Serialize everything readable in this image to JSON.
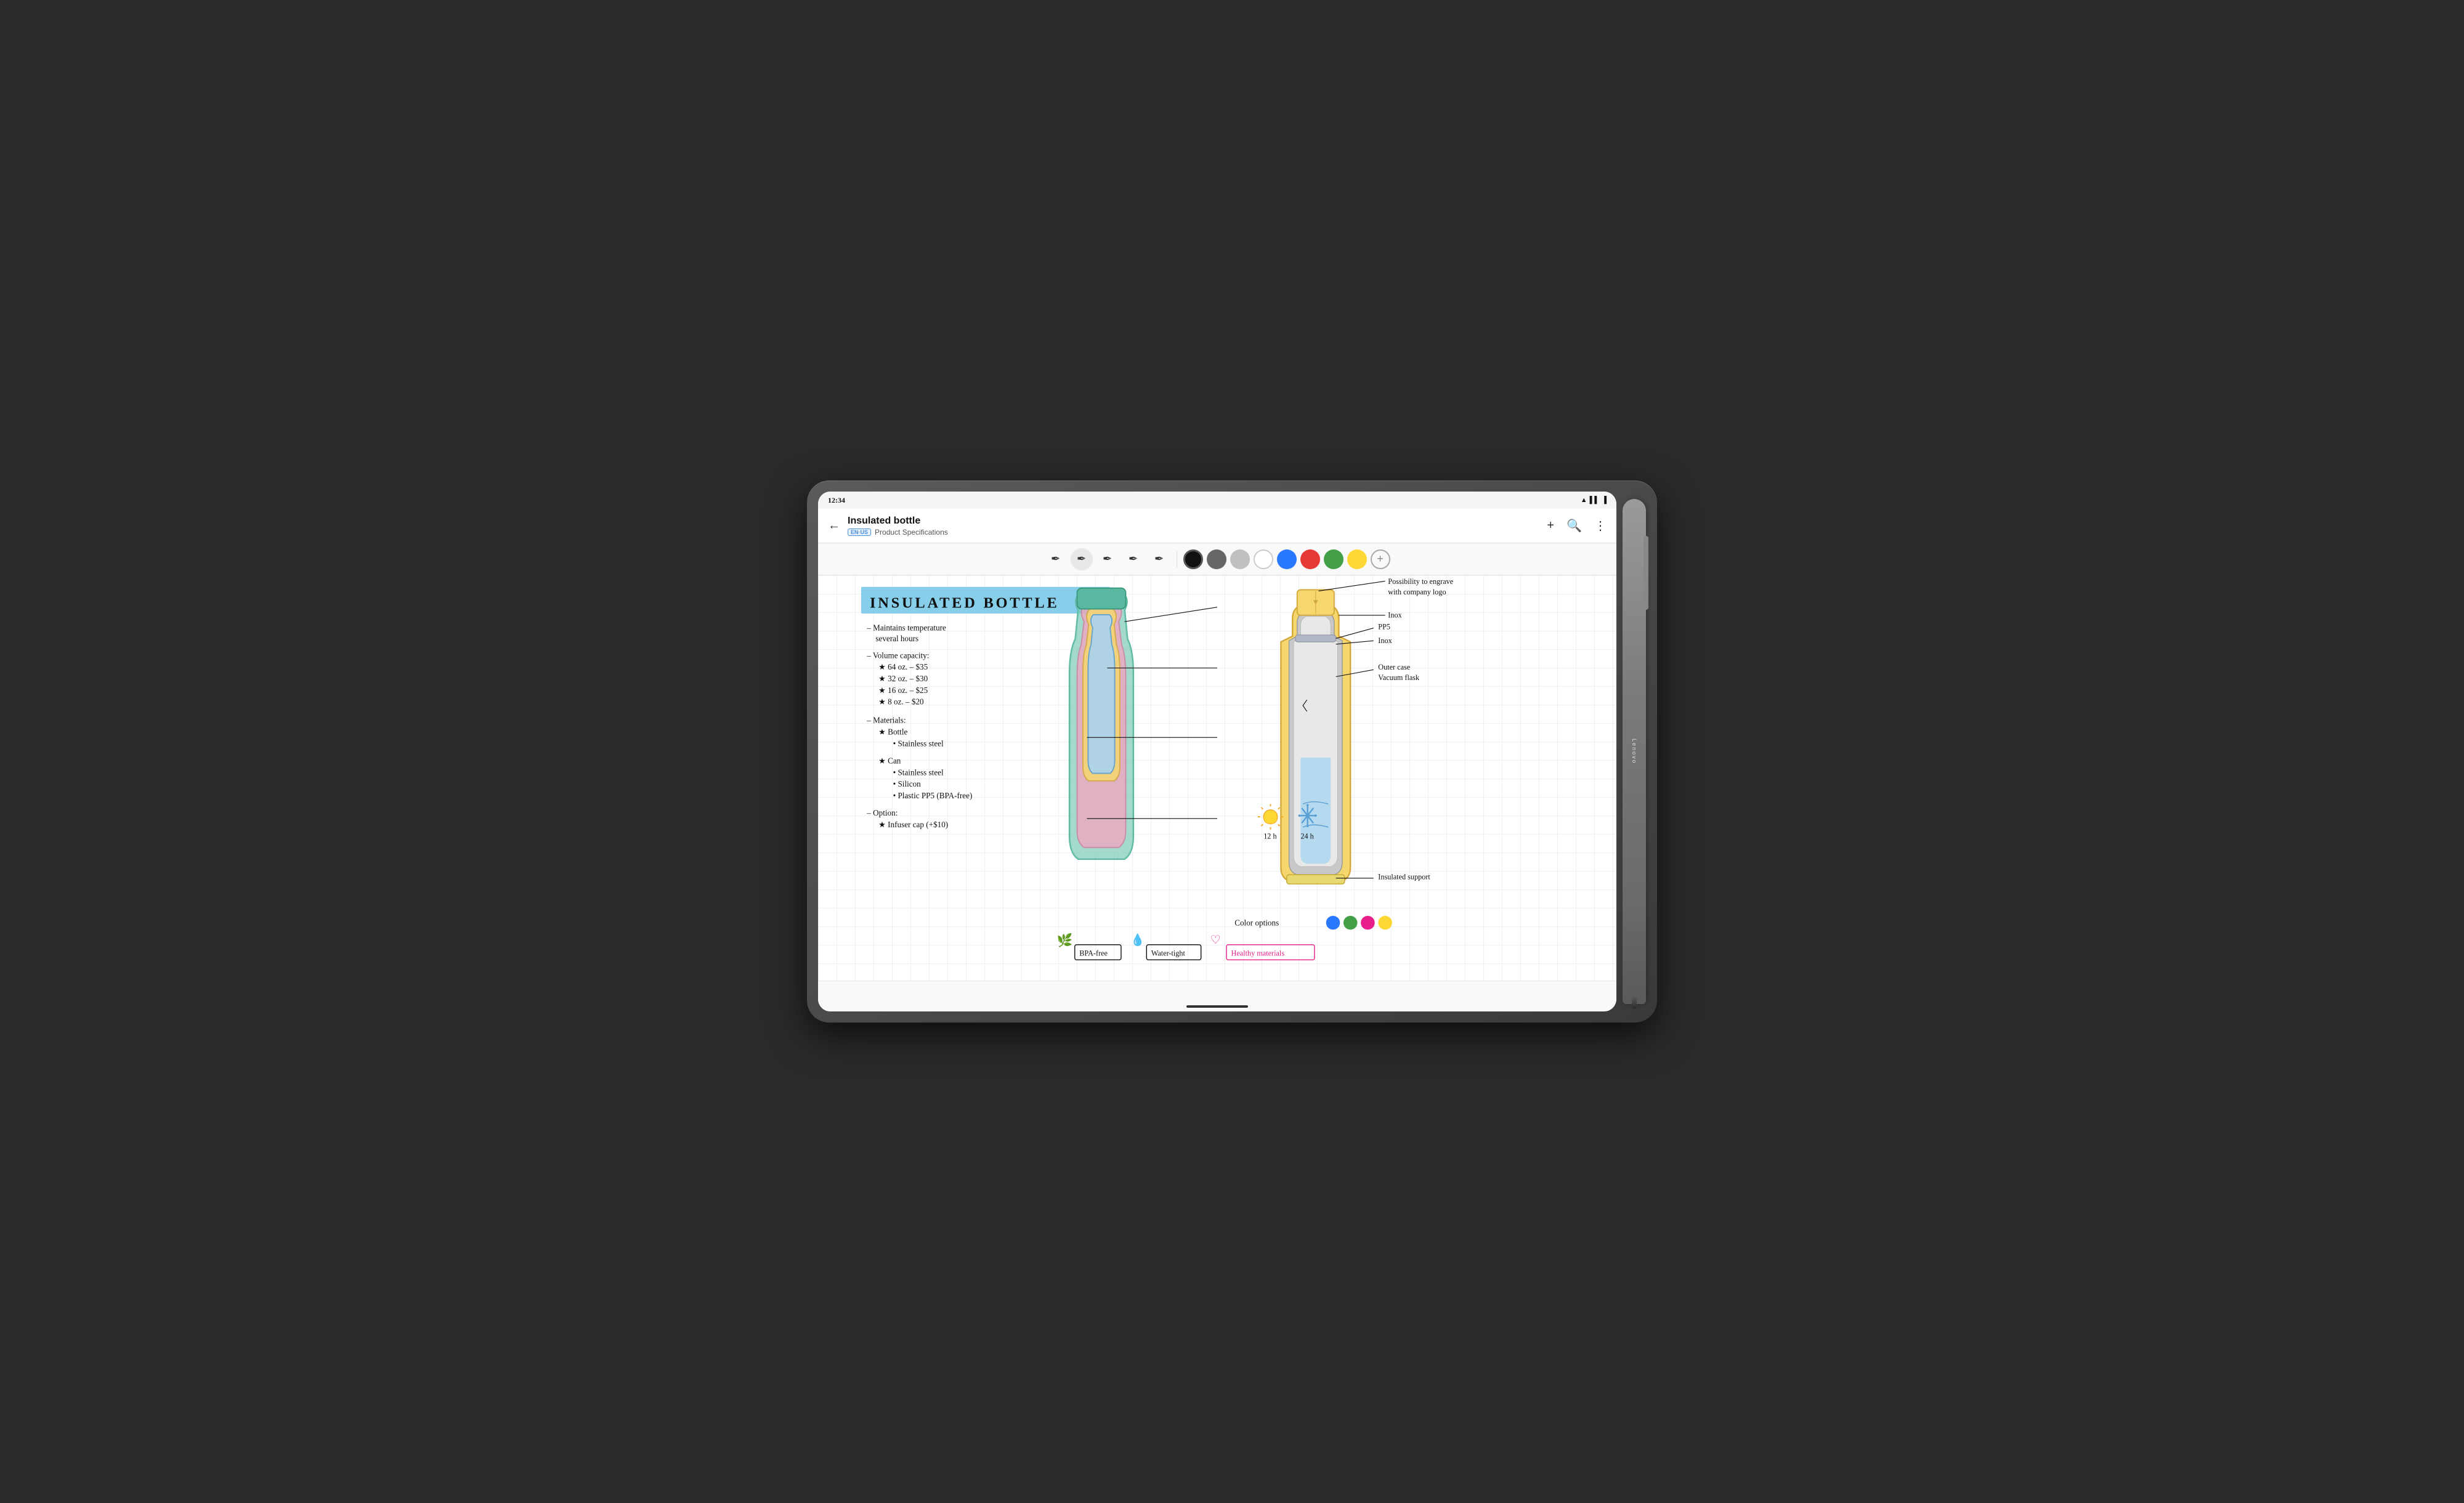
{
  "status_bar": {
    "time": "12:34",
    "wifi_icon": "wifi",
    "signal_icon": "signal",
    "battery_icon": "battery"
  },
  "app_bar": {
    "back_label": "←",
    "title": "Insulated bottle",
    "lang_badge": "EN·US",
    "subtitle": "Product Specifications",
    "actions": {
      "add": "+",
      "search": "🔍",
      "more": "⋮"
    }
  },
  "toolbar": {
    "pen_tools": [
      "pen1",
      "pen2",
      "pen3",
      "pen4",
      "pen5"
    ],
    "colors": {
      "black": "#111111",
      "dark_gray": "#666666",
      "light_gray": "#b0b0b0",
      "white": "#ffffff",
      "blue": "#2979ff",
      "red": "#e53935",
      "green": "#43a047",
      "yellow": "#fdd835"
    },
    "active_pen": 1,
    "active_color": "black"
  },
  "content": {
    "title": "INSULATED BOTTLE",
    "title_bg": "#87CEEB",
    "specs": [
      "– Maintains temperature",
      "  several hours",
      "– Volume capacity:",
      "  ★ 64 oz. – $35",
      "  ★ 32 oz. – $30",
      "  ★ 16 oz. – $25",
      "  ★ 8 oz. – $20",
      "– Materials:",
      "  ★ Bottle",
      "    • Stainless steel",
      "  ★ Can",
      "    • Stainless steel",
      "    • Silicon",
      "    • Plastic PP5 (BPA-free)",
      "– Option:",
      "  ★ Infuser cap (+$10)"
    ],
    "diagram_labels": {
      "engrave": "Possibility to engrave\nwith company logo",
      "inox_top": "Inox",
      "pp5": "PP5",
      "inox_mid": "Inox",
      "outer_case": "Outer case\nVacuum flask",
      "insulated_support": "Insulated support",
      "time_hot": "12 h",
      "time_cold": "24 h"
    },
    "color_options_label": "Color options",
    "color_options": [
      "#2979ff",
      "#43a047",
      "#e91e8c",
      "#fdd835"
    ],
    "badges": [
      {
        "icon": "🌿",
        "label": "BPA-free",
        "color": "black"
      },
      {
        "icon": "💧",
        "label": "Water-tight",
        "color": "black"
      },
      {
        "icon": "♡",
        "label": "Healthy materials",
        "color": "pink"
      }
    ]
  },
  "stylus": {
    "brand": "Lenovo"
  }
}
